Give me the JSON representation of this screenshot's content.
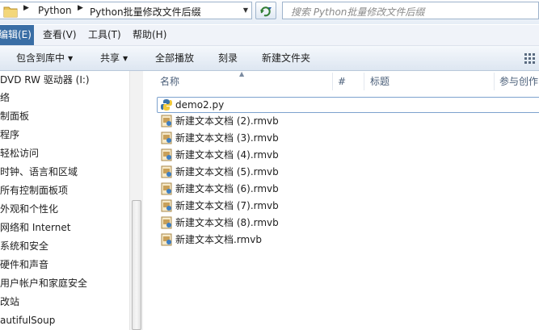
{
  "address": {
    "segments": [
      "Python",
      "Python批量修改文件后缀"
    ]
  },
  "search": {
    "placeholder": "搜索 Python批量修改文件后缀"
  },
  "menu": {
    "items": [
      "编辑(E)",
      "查看(V)",
      "工具(T)",
      "帮助(H)"
    ]
  },
  "toolbar": {
    "include_library": "包含到库中",
    "share": "共享",
    "play_all": "全部播放",
    "burn": "刻录",
    "new_folder": "新建文件夹"
  },
  "sidebar": {
    "items": [
      "DVD RW 驱动器 (I:)",
      "络",
      "制面板",
      "程序",
      "轻松访问",
      "时钟、语言和区域",
      "所有控制面板项",
      "外观和个性化",
      "网络和 Internet",
      "系统和安全",
      "硬件和声音",
      "用户帐户和家庭安全",
      "改站",
      "autifulSoup"
    ]
  },
  "columns": {
    "name": "名称",
    "number": "#",
    "title": "标题",
    "contributors": "参与创作"
  },
  "files": [
    {
      "name": "demo2.py",
      "icon": "python-file-icon"
    },
    {
      "name": "新建文本文档 (2).rmvb",
      "icon": "media-file-icon"
    },
    {
      "name": "新建文本文档 (3).rmvb",
      "icon": "media-file-icon"
    },
    {
      "name": "新建文本文档 (4).rmvb",
      "icon": "media-file-icon"
    },
    {
      "name": "新建文本文档 (5).rmvb",
      "icon": "media-file-icon"
    },
    {
      "name": "新建文本文档 (6).rmvb",
      "icon": "media-file-icon"
    },
    {
      "name": "新建文本文档 (7).rmvb",
      "icon": "media-file-icon"
    },
    {
      "name": "新建文本文档 (8).rmvb",
      "icon": "media-file-icon"
    },
    {
      "name": "新建文本文档.rmvb",
      "icon": "media-file-icon"
    }
  ],
  "colors": {
    "menu_highlight": "#3a6ea5",
    "header_text": "#4c607a",
    "selection_border": "#7da2ce"
  }
}
